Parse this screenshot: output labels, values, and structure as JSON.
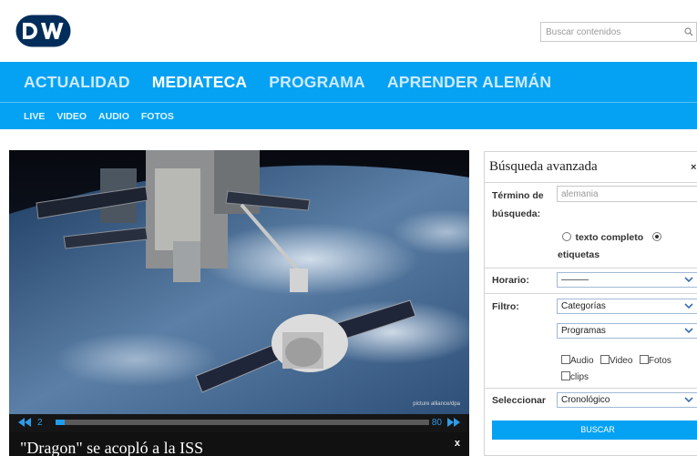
{
  "header": {
    "logo_text": "DW",
    "search_placeholder": "Buscar contenidos"
  },
  "nav": {
    "main": [
      "ACTUALIDAD",
      "MEDIATECA",
      "PROGRAMA",
      "APRENDER ALEMÁN"
    ],
    "active": "MEDIATECA",
    "sub": [
      "LIVE",
      "VIDEO",
      "AUDIO",
      "FOTOS"
    ]
  },
  "player": {
    "time_current": "2",
    "time_total": "80",
    "progress_fraction": 0.025,
    "credit": "picture alliance/dpa",
    "title": "\"Dragon\" se acopló a la ISS",
    "close_label": "x"
  },
  "advanced_search": {
    "title": "Búsqueda avanzada",
    "close_label": "×",
    "term_label_line1": "Término de",
    "term_label_line2": "búsqueda:",
    "term_value": "alemania",
    "radio_full_text": "texto completo",
    "radio_tags": "etiquetas",
    "radio_selected": "etiquetas",
    "schedule_label": "Horario:",
    "schedule_value": "———",
    "filter_label": "Filtro:",
    "filter_categories": "Categorías",
    "filter_programs": "Programas",
    "media_types": [
      "Audio",
      "Video",
      "Fotos",
      "clips"
    ],
    "select_label": "Seleccionar",
    "select_value": "Cronológico",
    "search_button": "BUSCAR"
  },
  "colors": {
    "brand_blue": "#05a2f3",
    "logo_navy": "#002d5a",
    "player_blue": "#1e9cf0"
  }
}
